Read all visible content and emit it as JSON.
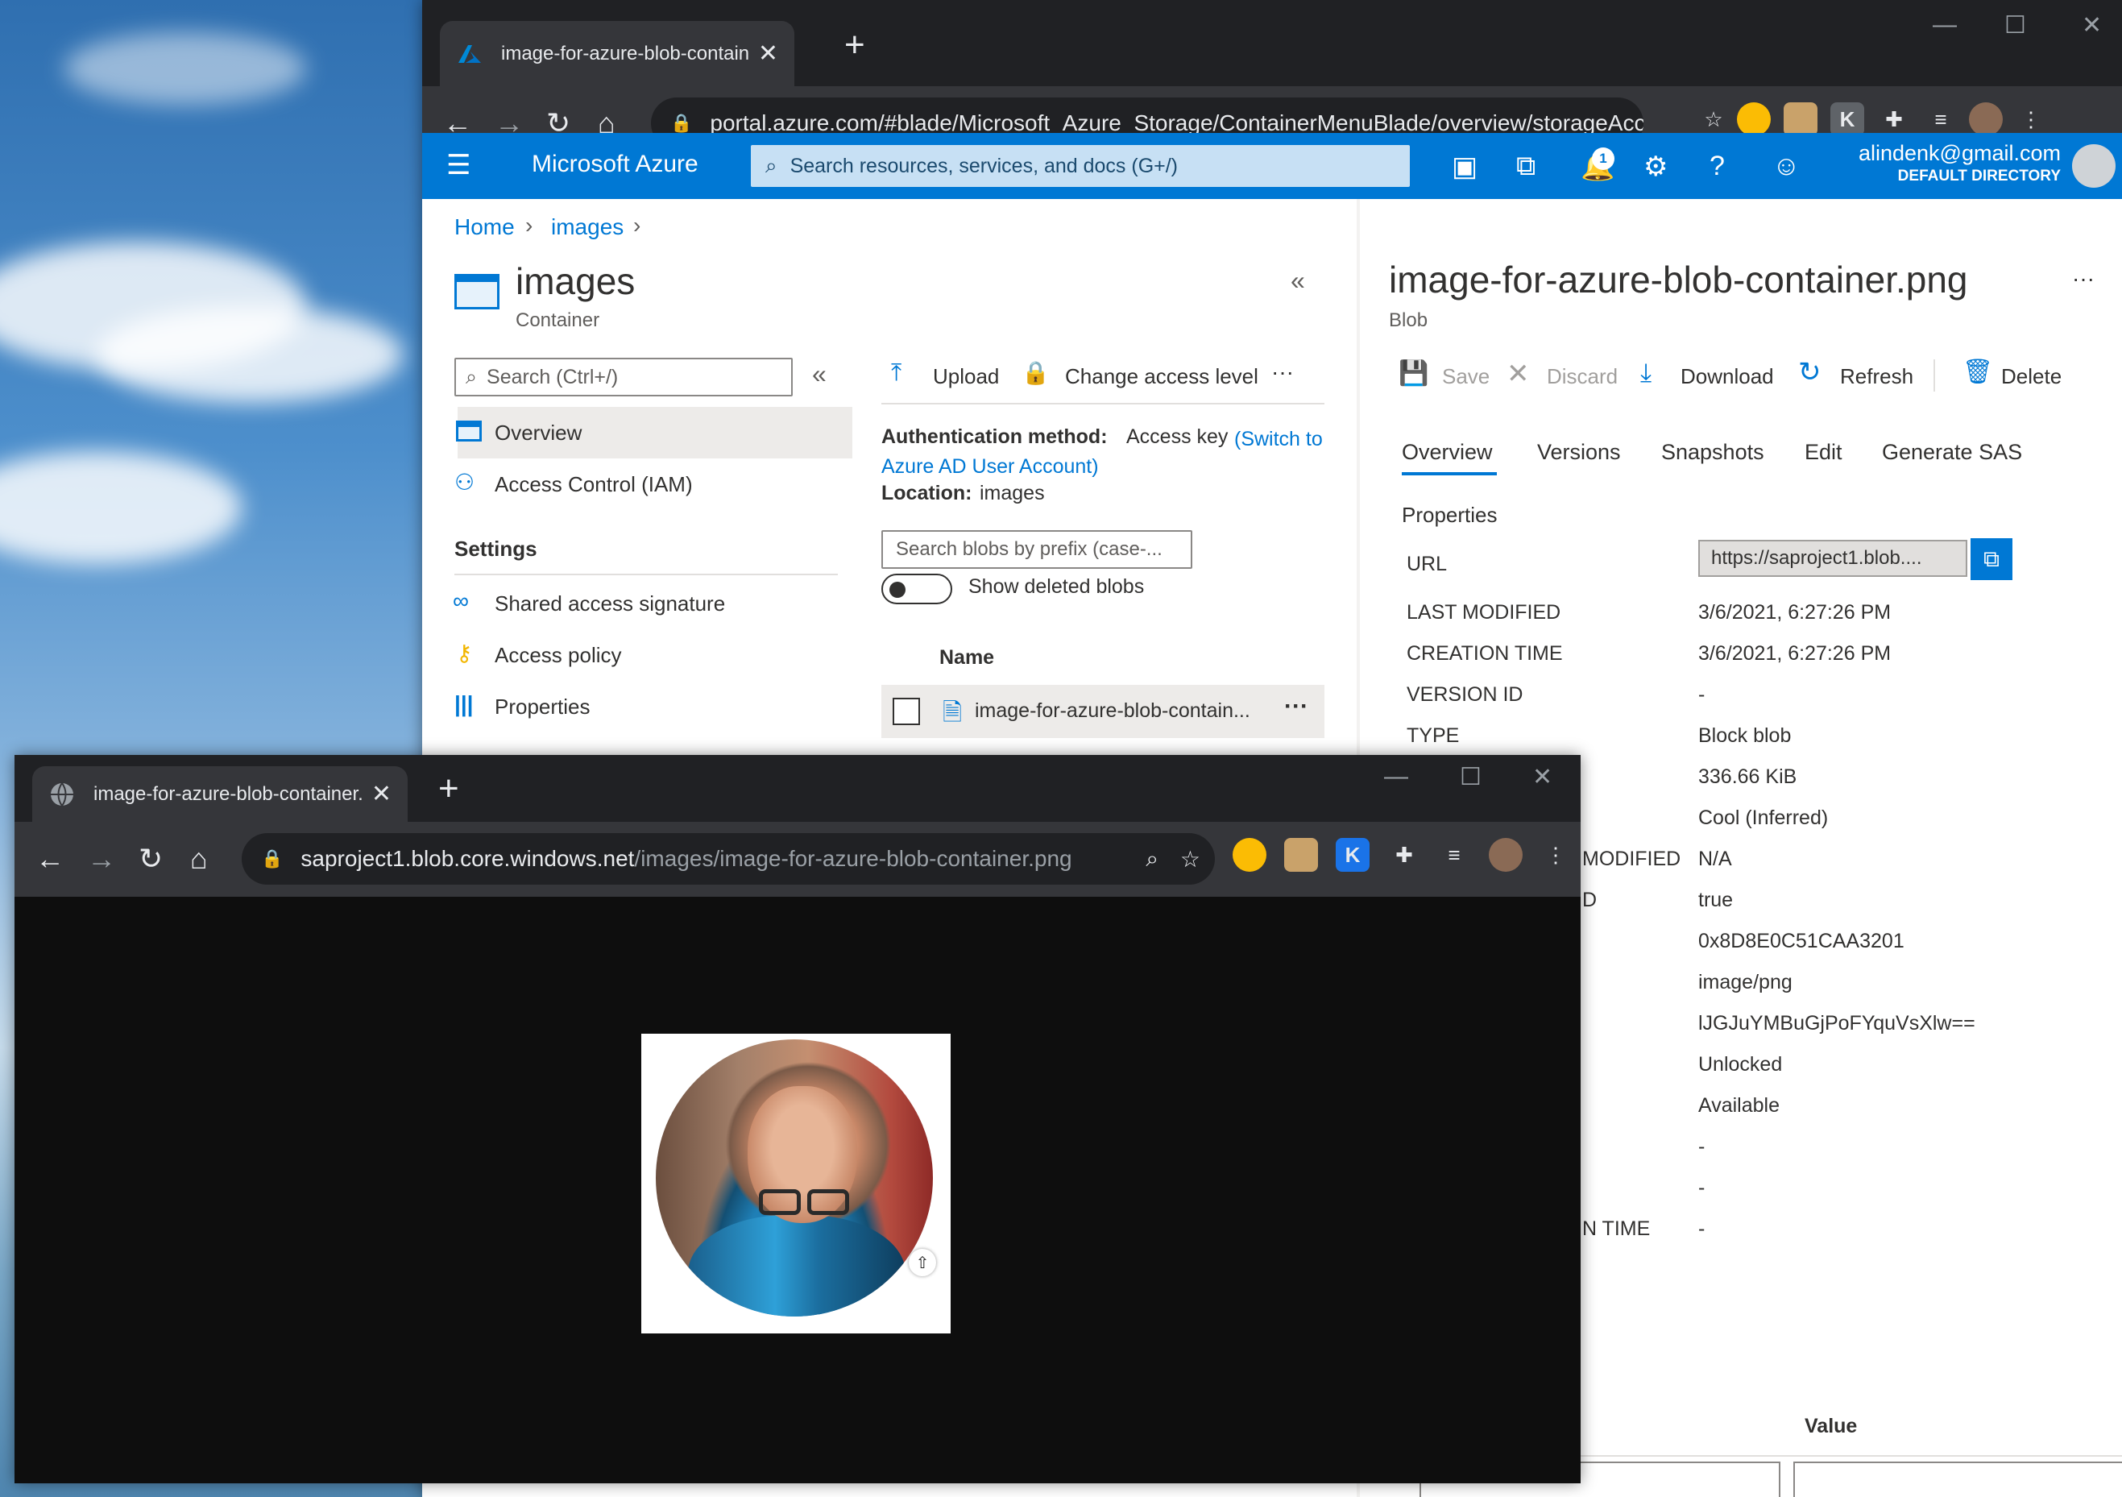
{
  "back_window": {
    "tab_title": "image-for-azure-blob-container.p",
    "address": "portal.azure.com/#blade/Microsoft_Azure_Storage/ContainerMenuBlade/overview/storageAccou...",
    "azure": {
      "brand": "Microsoft Azure",
      "search_placeholder": "Search resources, services, and docs (G+/)",
      "notification_count": "1",
      "user_email": "alindenk@gmail.com",
      "user_directory": "DEFAULT DIRECTORY"
    },
    "breadcrumb": [
      "Home",
      "images"
    ],
    "container": {
      "title": "images",
      "subtitle": "Container",
      "search_placeholder": "Search (Ctrl+/)",
      "menu": [
        {
          "label": "Overview",
          "icon": "container-icon"
        },
        {
          "label": "Access Control (IAM)",
          "icon": "people-icon"
        }
      ],
      "settings_heading": "Settings",
      "settings_items": [
        {
          "label": "Shared access signature",
          "icon": "link-icon"
        },
        {
          "label": "Access policy",
          "icon": "key-icon"
        },
        {
          "label": "Properties",
          "icon": "properties-icon"
        }
      ],
      "toolbar": {
        "upload": "Upload",
        "change_access": "Change access level",
        "more": "···"
      },
      "auth_label": "Authentication method:",
      "auth_value": "Access key",
      "auth_link": "(Switch to Azure AD User Account)",
      "location_label": "Location:",
      "location_value": "images",
      "blob_search_placeholder": "Search blobs by prefix (case-...",
      "show_deleted": "Show deleted blobs",
      "name_header": "Name",
      "blob_name": "image-for-azure-blob-contain..."
    },
    "blob": {
      "title": "image-for-azure-blob-container.png",
      "subtitle": "Blob",
      "more": "···",
      "actions": [
        "Save",
        "Discard",
        "Download",
        "Refresh",
        "Delete"
      ],
      "tabs": [
        "Overview",
        "Versions",
        "Snapshots",
        "Edit",
        "Generate SAS"
      ],
      "properties_heading": "Properties",
      "url_label": "URL",
      "url_value": "https://saproject1.blob....",
      "rows": [
        {
          "label": "LAST MODIFIED",
          "value": "3/6/2021, 6:27:26 PM"
        },
        {
          "label": "CREATION TIME",
          "value": "3/6/2021, 6:27:26 PM"
        },
        {
          "label": "VERSION ID",
          "value": "-"
        },
        {
          "label": "TYPE",
          "value": "Block blob"
        }
      ],
      "partial_rows": [
        {
          "label": "",
          "value": "336.66 KiB"
        },
        {
          "label": "",
          "value": "Cool (Inferred)"
        },
        {
          "label": "MODIFIED",
          "value": "N/A"
        },
        {
          "label": "D",
          "value": "true"
        },
        {
          "label": "",
          "value": "0x8D8E0C51CAA3201"
        },
        {
          "label": "",
          "value": "image/png"
        },
        {
          "label": "",
          "value": "lJGJuYMBuGjPoFYquVsXlw=="
        },
        {
          "label": "",
          "value": "Unlocked"
        },
        {
          "label": "",
          "value": "Available"
        },
        {
          "label": "",
          "value": "-"
        },
        {
          "label": "",
          "value": "-"
        },
        {
          "label": "N TIME",
          "value": "-"
        }
      ],
      "value_header": "Value"
    }
  },
  "front_window": {
    "tab_title": "image-for-azure-blob-container.p",
    "address_host": "saproject1.blob.core.windows.net",
    "address_path": "/images/image-for-azure-blob-container.png"
  },
  "colors": {
    "azure_blue": "#0078d4",
    "chrome_dark": "#202124",
    "chrome_toolbar": "#35363a"
  }
}
